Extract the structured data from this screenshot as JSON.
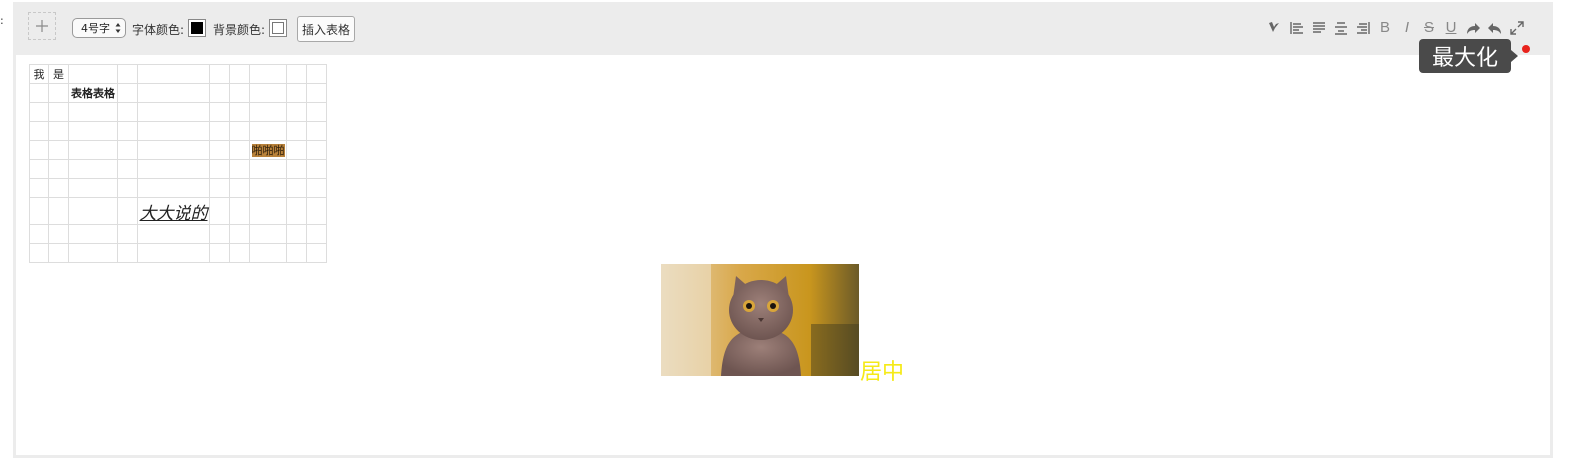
{
  "edge_mark": ":",
  "toolbar": {
    "add_button": "plus-icon",
    "font_size_select": {
      "selected": "4号字"
    },
    "font_color_label": "字体颜色:",
    "font_color": "#000000",
    "bg_color_label": "背景颜色:",
    "bg_color": "#ffffff",
    "insert_table_label": "插入表格",
    "tools": [
      {
        "icon": "clear-format-icon"
      },
      {
        "icon": "align-left-icon"
      },
      {
        "icon": "align-justify-icon"
      },
      {
        "icon": "align-center-icon"
      },
      {
        "icon": "align-right-icon"
      },
      {
        "icon": "bold-icon",
        "text": "B"
      },
      {
        "icon": "italic-icon",
        "text": "I"
      },
      {
        "icon": "strikethrough-icon",
        "text": "S"
      },
      {
        "icon": "underline-icon",
        "text": "U"
      },
      {
        "icon": "redo-icon"
      },
      {
        "icon": "undo-icon"
      },
      {
        "icon": "maximize-icon"
      }
    ],
    "tooltip": "最大化"
  },
  "table": {
    "rows": [
      [
        "我",
        "是",
        "",
        "",
        "",
        "",
        "",
        "",
        "",
        ""
      ],
      [
        "",
        "",
        "表格表格",
        "",
        "",
        "",
        "",
        "",
        "",
        ""
      ],
      [
        "",
        "",
        "",
        "",
        "",
        "",
        "",
        "",
        "",
        ""
      ],
      [
        "",
        "",
        "",
        "",
        "",
        "",
        "",
        "",
        "",
        ""
      ],
      [
        "",
        "",
        "",
        "",
        "",
        "",
        "",
        "啪啪啪",
        "",
        ""
      ],
      [
        "",
        "",
        "",
        "",
        "",
        "",
        "",
        "",
        "",
        ""
      ],
      [
        "",
        "",
        "",
        "",
        "",
        "",
        "",
        "",
        "",
        ""
      ],
      [
        "",
        "",
        "",
        "",
        "大大说的",
        "",
        "",
        "",
        "",
        ""
      ],
      [
        "",
        "",
        "",
        "",
        "",
        "",
        "",
        "",
        "",
        ""
      ],
      [
        "",
        "",
        "",
        "",
        "",
        "",
        "",
        "",
        "",
        ""
      ]
    ],
    "highlight_color": "#b9823a"
  },
  "content": {
    "image": "cat-photo",
    "center_text": "居中",
    "center_text_color": "#f5ea17"
  }
}
